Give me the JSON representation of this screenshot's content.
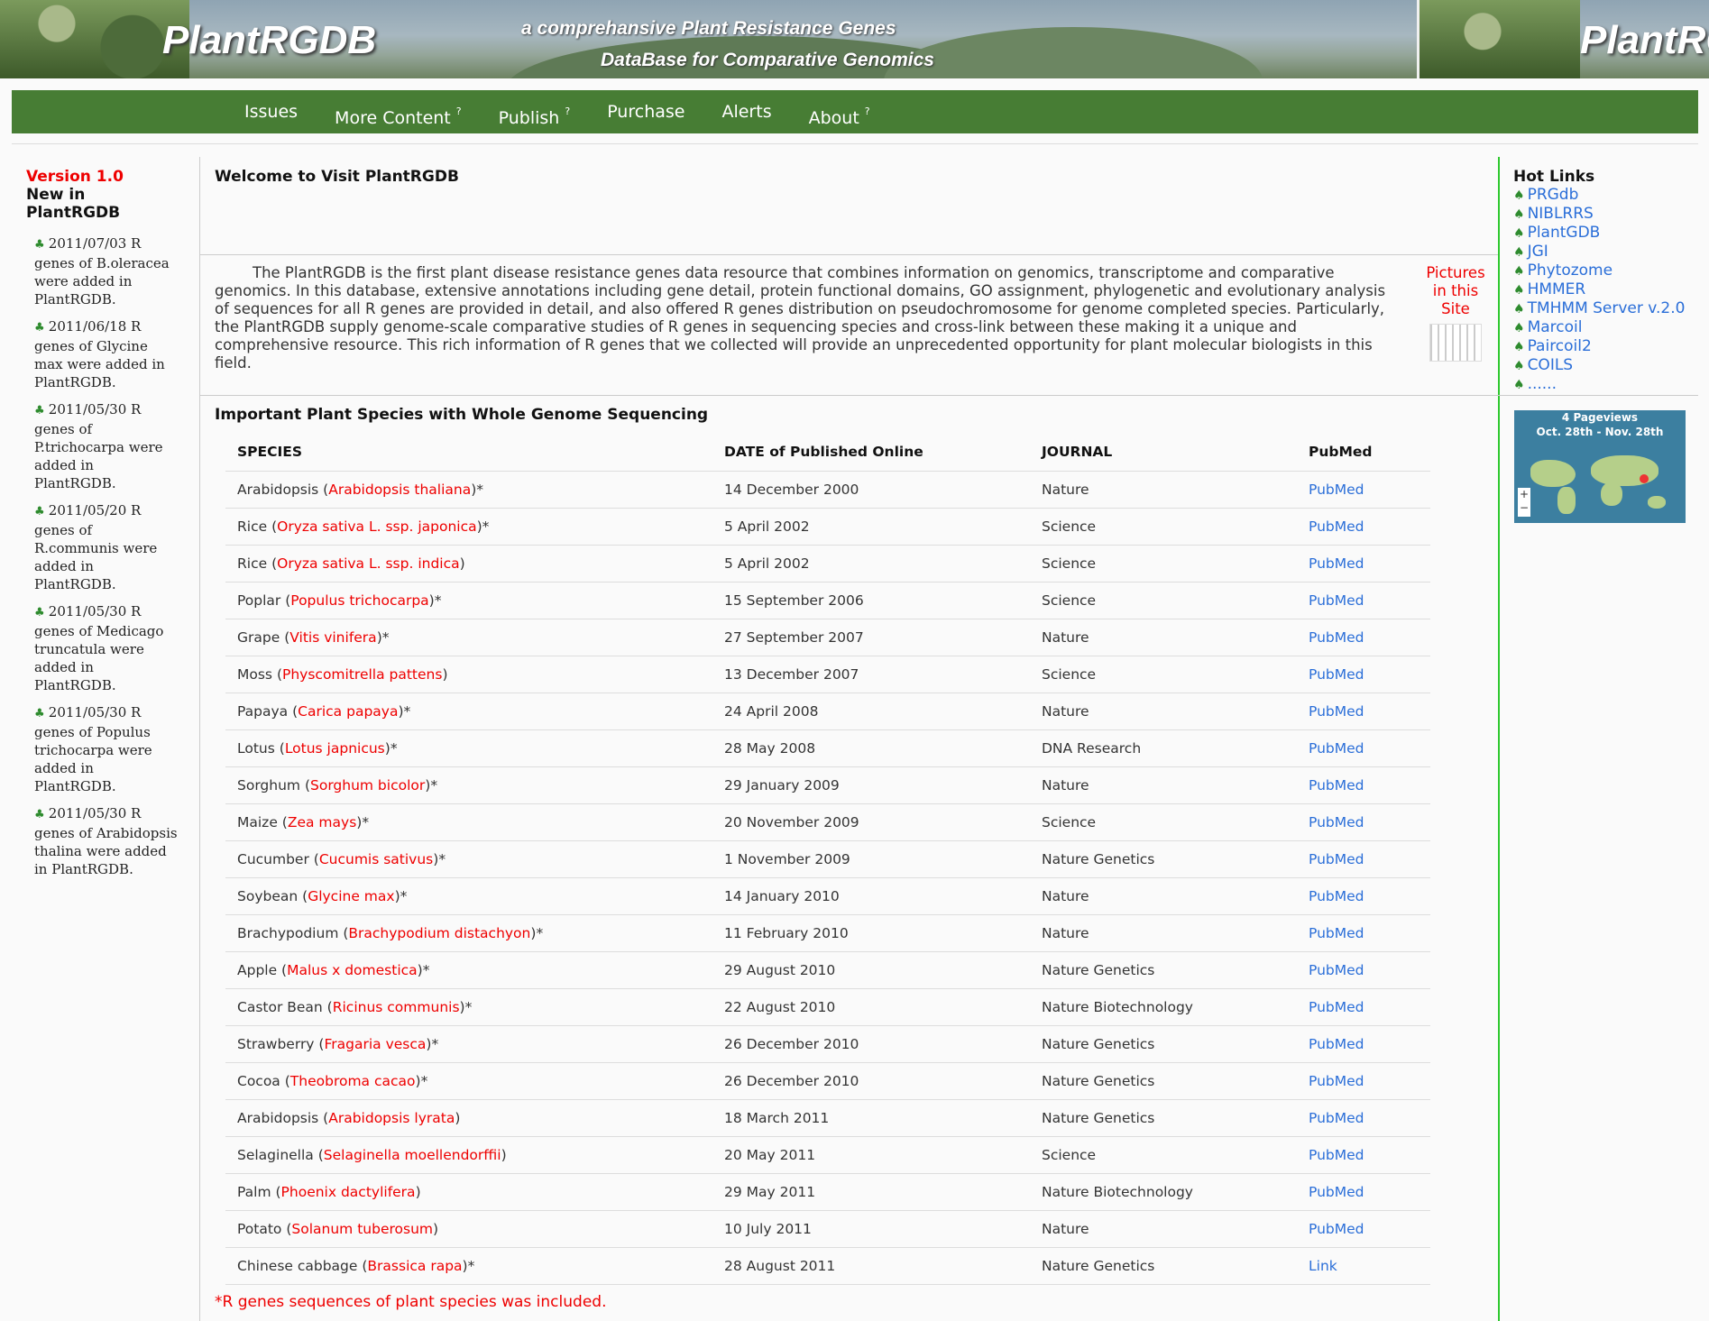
{
  "banner": {
    "logo": "PlantRGDB",
    "logo_repeat": "PlantRC",
    "tagline_1": "a comprehansive Plant Resistance Genes",
    "tagline_2": "DataBase for Comparative Genomics"
  },
  "nav": [
    {
      "label": "Issues",
      "sup": ""
    },
    {
      "label": "More Content",
      "sup": "?"
    },
    {
      "label": "Publish",
      "sup": "?"
    },
    {
      "label": "Purchase",
      "sup": ""
    },
    {
      "label": "Alerts",
      "sup": ""
    },
    {
      "label": "About",
      "sup": "?"
    }
  ],
  "left": {
    "version": "Version 1.0",
    "new_in": "New in PlantRGDB",
    "news": [
      "2011/07/03 R genes of B.oleracea were added in PlantRGDB.",
      "2011/06/18 R genes of Glycine max were added in PlantRGDB.",
      "2011/05/30 R genes of P.trichocarpa were added in PlantRGDB.",
      "2011/05/20 R genes of R.communis were added in PlantRGDB.",
      "2011/05/30 R genes of Medicago truncatula were added in PlantRGDB.",
      "2011/05/30 R genes of Populus trichocarpa were added in PlantRGDB.",
      "2011/05/30 R genes of Arabidopsis thalina were added in PlantRGDB."
    ]
  },
  "main": {
    "welcome": "Welcome to Visit PlantRGDB",
    "intro": "The PlantRGDB is the first plant disease resistance genes data resource that combines information on genomics, transcriptome and comparative genomics. In this database, extensive annotations including gene detail, protein functional domains, GO assignment, phylogenetic and evolutionary analysis of sequences for all R genes are provided in detail, and also offered R genes distribution on pseudochromosome for genome completed species. Particularly, the PlantRGDB supply genome-scale comparative studies of R genes in sequencing species and cross-link between these making it a unique and comprehensive resource. This rich information of R genes that we collected will provide an unprecedented opportunity for plant molecular biologists in this field.",
    "pictures_label": "Pictures in this Site",
    "important_title": "Important Plant Species with Whole Genome Sequencing",
    "table_headers": [
      "SPECIES",
      "DATE of Published Online",
      "JOURNAL",
      "PubMed"
    ],
    "rows": [
      {
        "common": "Arabidopsis",
        "latin": "Arabidopsis thaliana",
        "star": "*",
        "date": "14 December 2000",
        "journal": "Nature",
        "link": "PubMed"
      },
      {
        "common": "Rice",
        "latin": "Oryza sativa L. ssp. japonica",
        "star": "*",
        "date": "5 April 2002",
        "journal": "Science",
        "link": "PubMed"
      },
      {
        "common": "Rice",
        "latin": "Oryza sativa  L. ssp. indica",
        "star": "",
        "date": "5 April 2002",
        "journal": "Science",
        "link": "PubMed"
      },
      {
        "common": "Poplar",
        "latin": "Populus trichocarpa",
        "star": "*",
        "date": "15 September 2006",
        "journal": "Science",
        "link": "PubMed"
      },
      {
        "common": "Grape",
        "latin": "Vitis vinifera",
        "star": "*",
        "date": "27 September 2007",
        "journal": "Nature",
        "link": "PubMed"
      },
      {
        "common": "Moss",
        "latin": "Physcomitrella pattens",
        "star": "",
        "date": "13 December 2007",
        "journal": "Science",
        "link": "PubMed"
      },
      {
        "common": "Papaya",
        "latin": "Carica papaya",
        "star": "*",
        "date": "24 April 2008",
        "journal": "Nature",
        "link": "PubMed"
      },
      {
        "common": "Lotus",
        "latin": "Lotus japnicus",
        "star": "*",
        "date": "28 May 2008",
        "journal": "DNA Research",
        "link": "PubMed"
      },
      {
        "common": "Sorghum",
        "latin": "Sorghum bicolor",
        "star": "*",
        "date": "29 January 2009",
        "journal": "Nature",
        "link": "PubMed"
      },
      {
        "common": "Maize",
        "latin": "Zea mays",
        "star": "*",
        "date": "20 November 2009",
        "journal": "Science",
        "link": "PubMed"
      },
      {
        "common": "Cucumber",
        "latin": "Cucumis sativus",
        "star": "*",
        "date": "1 November 2009",
        "journal": "Nature Genetics",
        "link": "PubMed"
      },
      {
        "common": "Soybean",
        "latin": "Glycine max",
        "star": "*",
        "date": "14 January 2010",
        "journal": "Nature",
        "link": "PubMed"
      },
      {
        "common": "Brachypodium",
        "latin": "Brachypodium distachyon",
        "star": "*",
        "date": "11 February 2010",
        "journal": "Nature",
        "link": "PubMed"
      },
      {
        "common": "Apple",
        "latin": "Malus x domestica",
        "star": "*",
        "date": "29 August 2010",
        "journal": "Nature Genetics",
        "link": "PubMed"
      },
      {
        "common": "Castor Bean",
        "latin": "Ricinus communis",
        "star": "*",
        "date": "22 August 2010",
        "journal": "Nature Biotechnology",
        "link": "PubMed"
      },
      {
        "common": "Strawberry",
        "latin": "Fragaria vesca",
        "star": "*",
        "date": "26 December 2010",
        "journal": "Nature Genetics",
        "link": "PubMed"
      },
      {
        "common": "Cocoa",
        "latin": "Theobroma cacao",
        "star": "*",
        "date": "26 December 2010",
        "journal": "Nature Genetics",
        "link": "PubMed"
      },
      {
        "common": "Arabidopsis",
        "latin": "Arabidopsis lyrata",
        "star": "",
        "date": "18 March 2011",
        "journal": "Nature Genetics",
        "link": "PubMed"
      },
      {
        "common": "Selaginella",
        "latin": "Selaginella moellendorffii",
        "star": "",
        "date": "20 May 2011",
        "journal": "Science",
        "link": "PubMed"
      },
      {
        "common": "Palm",
        "latin": "Phoenix dactylifera",
        "star": "",
        "date": "29 May 2011",
        "journal": "Nature Biotechnology",
        "link": "PubMed"
      },
      {
        "common": "Potato",
        "latin": "Solanum tuberosum",
        "star": "",
        "date": "10 July 2011",
        "journal": "Nature",
        "link": "PubMed"
      },
      {
        "common": "Chinese cabbage",
        "latin": "Brassica rapa",
        "star": "*",
        "date": "28 August 2011",
        "journal": "Nature Genetics",
        "link": "Link"
      }
    ],
    "footnote_star": "*",
    "footnote_text": "R genes sequences of plant species was included."
  },
  "right": {
    "hot_links_title": "Hot Links",
    "links": [
      "PRGdb",
      "NIBLRRS",
      "PlantGDB",
      "JGI",
      "Phytozome",
      "HMMER",
      "TMHMM Server v.2.0",
      "Marcoil",
      "Paircoil2",
      "COILS",
      "......"
    ],
    "map_line1": "4 Pageviews",
    "map_line2": "Oct. 28th - Nov. 28th"
  },
  "colors": {
    "nav_green": "#477d34",
    "link_blue": "#2a6ed8",
    "latin_red": "#e00000",
    "divider_green": "#2ec82e"
  },
  "icons": {
    "bullet": "club-icon"
  }
}
